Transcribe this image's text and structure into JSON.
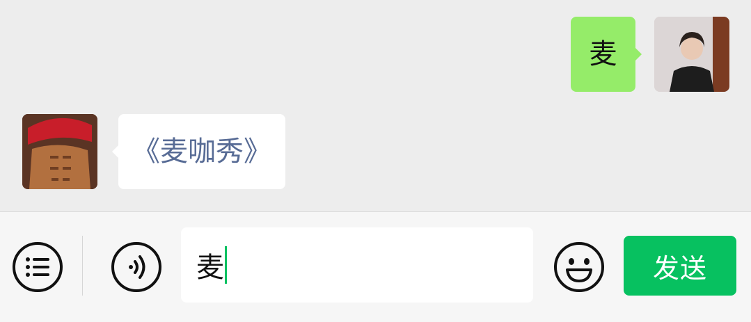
{
  "messages": [
    {
      "side": "self",
      "text": "麦"
    },
    {
      "side": "other",
      "text": "《麦咖秀》"
    }
  ],
  "composer": {
    "input_value": "麦",
    "send_label": "发送"
  },
  "colors": {
    "chat_background": "#ededed",
    "self_bubble": "#95ec69",
    "other_bubble": "#ffffff",
    "link_text": "#576b95",
    "accent_green": "#07c160"
  },
  "icons": [
    "list-icon",
    "voice-icon",
    "emoji-icon"
  ]
}
